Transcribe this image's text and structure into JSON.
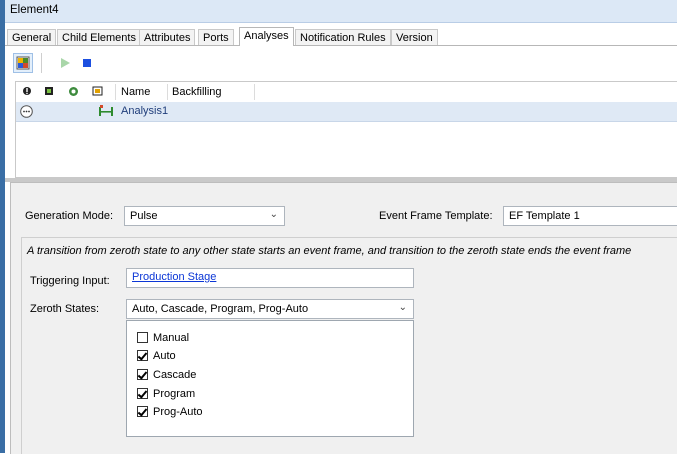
{
  "window": {
    "title": "Element4"
  },
  "tabs": [
    {
      "label": "General"
    },
    {
      "label": "Child Elements"
    },
    {
      "label": "Attributes"
    },
    {
      "label": "Ports"
    },
    {
      "label": "Analyses",
      "active": true
    },
    {
      "label": "Notification Rules"
    },
    {
      "label": "Version"
    }
  ],
  "toolbar": {
    "icons": [
      "grid-select-icon",
      "play-icon",
      "stop-icon"
    ]
  },
  "grid": {
    "headers": [
      "Name",
      "Backfilling"
    ],
    "header_icons": [
      "status-icon",
      "enable-icon",
      "refresh-icon",
      "template-icon"
    ],
    "rows": [
      {
        "name": "Analysis1",
        "backfilling": ""
      }
    ]
  },
  "settings": {
    "generation_mode_label": "Generation Mode:",
    "generation_mode_value": "Pulse",
    "ef_template_label": "Event Frame Template:",
    "ef_template_value": "EF Template 1",
    "description": "A transition from zeroth state to any other state starts an event frame, and transition to the zeroth state ends the event frame",
    "triggering_input_label": "Triggering Input:",
    "triggering_input_value": "Production Stage",
    "zeroth_states_label": "Zeroth States:",
    "zeroth_states_value": "Auto, Cascade, Program, Prog-Auto",
    "zeroth_options": [
      {
        "label": "Manual",
        "checked": false
      },
      {
        "label": "Auto",
        "checked": true
      },
      {
        "label": "Cascade",
        "checked": true
      },
      {
        "label": "Program",
        "checked": true
      },
      {
        "label": "Prog-Auto",
        "checked": true
      }
    ]
  },
  "colors": {
    "accent": "#0b36d6",
    "title_bg": "#dce8f6",
    "row_selected": "#dfe9f5",
    "stop": "#1c4fe0",
    "play": "#9fd19f"
  }
}
